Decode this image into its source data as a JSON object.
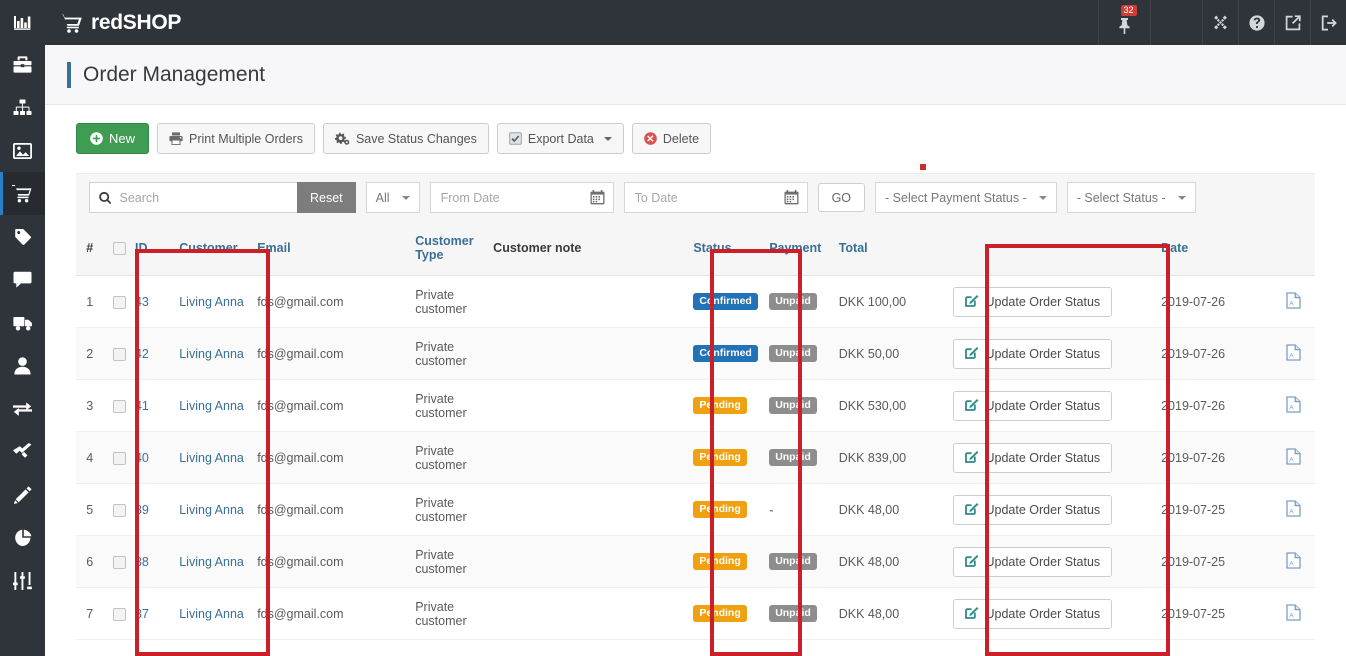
{
  "topbar": {
    "brand": "redSHOP",
    "brand_icon": "shopping-cart-icon",
    "menu_toggle_icon": "menu-bars-icon",
    "notification_badge": "32",
    "notification_icon": "pin-icon",
    "joomla_icon": "joomla-icon",
    "help_icon": "help-circle-icon",
    "preview_icon": "external-link-icon",
    "logout_icon": "logout-icon"
  },
  "sidebar": {
    "items": [
      {
        "name": "dashboard",
        "icon": "chart-bar-icon",
        "active": false
      },
      {
        "name": "products",
        "icon": "briefcase-icon",
        "active": false
      },
      {
        "name": "categories",
        "icon": "sitemap-icon",
        "active": false
      },
      {
        "name": "media",
        "icon": "image-icon",
        "active": false
      },
      {
        "name": "orders",
        "icon": "shopping-cart-icon",
        "active": true
      },
      {
        "name": "discounts",
        "icon": "tag-icon",
        "active": false
      },
      {
        "name": "reviews",
        "icon": "comment-icon",
        "active": false
      },
      {
        "name": "shipping",
        "icon": "truck-icon",
        "active": false
      },
      {
        "name": "users",
        "icon": "user-icon",
        "active": false
      },
      {
        "name": "exchange",
        "icon": "exchange-icon",
        "active": false
      },
      {
        "name": "tools",
        "icon": "hammer-icon",
        "active": false
      },
      {
        "name": "edit",
        "icon": "pencil-icon",
        "active": false
      },
      {
        "name": "reports",
        "icon": "pie-chart-icon",
        "active": false
      },
      {
        "name": "configuration",
        "icon": "sliders-icon",
        "active": false
      }
    ]
  },
  "page": {
    "title": "Order Management"
  },
  "toolbar": {
    "new_label": "New",
    "print_label": "Print Multiple Orders",
    "save_status_label": "Save Status Changes",
    "export_label": "Export Data",
    "delete_label": "Delete"
  },
  "filters": {
    "search_placeholder": "Search",
    "search_value": "",
    "reset_label": "Reset",
    "all_label": "All",
    "from_date_placeholder": "From Date",
    "to_date_placeholder": "To Date",
    "go_label": "GO",
    "payment_status_label": "- Select Payment Status -",
    "status_label": "- Select Status -"
  },
  "table": {
    "headers": {
      "num": "#",
      "id": "ID",
      "customer": "Customer",
      "email": "Email",
      "customer_type": "Customer\nType",
      "customer_type_line1": "Customer",
      "customer_type_line2": "Type",
      "customer_note": "Customer note",
      "status": "Status",
      "payment": "Payment",
      "total": "Total",
      "action": "",
      "date": "Date",
      "pdf": ""
    },
    "update_button_label": "Update Order Status",
    "rows": [
      {
        "num": "1",
        "id": "43",
        "customer": "Living Anna",
        "email": "fds@gmail.com",
        "customer_type": "Private customer",
        "note": "",
        "status": "Confirmed",
        "status_kind": "confirmed",
        "payment": "Unpaid",
        "payment_kind": "unpaid",
        "total": "DKK 100,00",
        "date": "2019-07-26"
      },
      {
        "num": "2",
        "id": "42",
        "customer": "Living Anna",
        "email": "fds@gmail.com",
        "customer_type": "Private customer",
        "note": "",
        "status": "Confirmed",
        "status_kind": "confirmed",
        "payment": "Unpaid",
        "payment_kind": "unpaid",
        "total": "DKK 50,00",
        "date": "2019-07-26"
      },
      {
        "num": "3",
        "id": "41",
        "customer": "Living Anna",
        "email": "fds@gmail.com",
        "customer_type": "Private customer",
        "note": "",
        "status": "Pending",
        "status_kind": "pending",
        "payment": "Unpaid",
        "payment_kind": "unpaid",
        "total": "DKK 530,00",
        "date": "2019-07-26"
      },
      {
        "num": "4",
        "id": "40",
        "customer": "Living Anna",
        "email": "fds@gmail.com",
        "customer_type": "Private customer",
        "note": "",
        "status": "Pending",
        "status_kind": "pending",
        "payment": "Unpaid",
        "payment_kind": "unpaid",
        "total": "DKK 839,00",
        "date": "2019-07-26"
      },
      {
        "num": "5",
        "id": "39",
        "customer": "Living Anna",
        "email": "fds@gmail.com",
        "customer_type": "Private customer",
        "note": "",
        "status": "Pending",
        "status_kind": "pending",
        "payment": "-",
        "payment_kind": "dash",
        "total": "DKK 48,00",
        "date": "2019-07-25"
      },
      {
        "num": "6",
        "id": "38",
        "customer": "Living Anna",
        "email": "fds@gmail.com",
        "customer_type": "Private customer",
        "note": "",
        "status": "Pending",
        "status_kind": "pending",
        "payment": "Unpaid",
        "payment_kind": "unpaid",
        "total": "DKK 48,00",
        "date": "2019-07-25"
      },
      {
        "num": "7",
        "id": "37",
        "customer": "Living Anna",
        "email": "fds@gmail.com",
        "customer_type": "Private customer",
        "note": "",
        "status": "Pending",
        "status_kind": "pending",
        "payment": "Unpaid",
        "payment_kind": "unpaid",
        "total": "DKK 48,00",
        "date": "2019-07-25"
      }
    ]
  },
  "annotations": {
    "boxes": [
      {
        "name": "id-customer-highlight"
      },
      {
        "name": "status-highlight"
      },
      {
        "name": "update-order-status-highlight"
      }
    ],
    "dot": {
      "name": "red-dot-marker"
    }
  },
  "colors": {
    "sidebar_bg": "#2f343a",
    "accent_blue": "#3a6f96",
    "primary_green": "#3e9c53",
    "badge_confirmed": "#2172b6",
    "badge_pending": "#f0a112",
    "badge_unpaid": "#8d8d8d",
    "annotation_red": "#cc2029"
  }
}
